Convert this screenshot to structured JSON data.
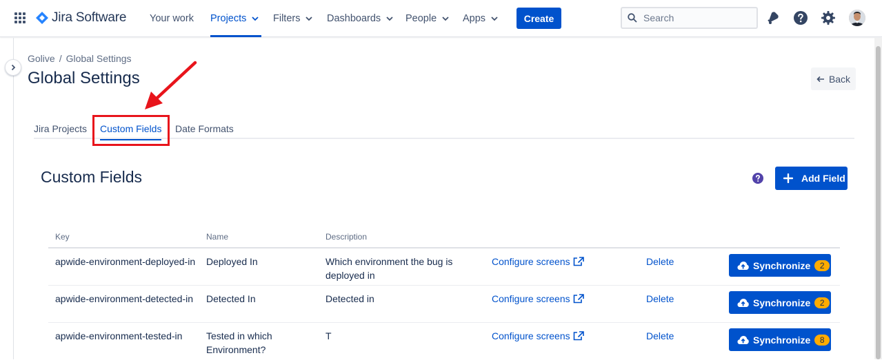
{
  "topnav": {
    "product_name": "Jira Software",
    "items": [
      {
        "label": "Your work",
        "has_menu": false
      },
      {
        "label": "Projects",
        "has_menu": true,
        "active": true
      },
      {
        "label": "Filters",
        "has_menu": true
      },
      {
        "label": "Dashboards",
        "has_menu": true
      },
      {
        "label": "People",
        "has_menu": true
      },
      {
        "label": "Apps",
        "has_menu": true
      }
    ],
    "create_label": "Create",
    "search_placeholder": "Search",
    "icons": [
      "app-switcher-icon",
      "notifications-icon",
      "help-icon",
      "settings-icon",
      "avatar"
    ]
  },
  "breadcrumb": {
    "root": "Golive",
    "separator": "/",
    "current": "Global Settings"
  },
  "page_title": "Global Settings",
  "back_label": "Back",
  "tabs": [
    {
      "label": "Jira Projects"
    },
    {
      "label": "Custom Fields",
      "active": true
    },
    {
      "label": "Date Formats"
    }
  ],
  "section": {
    "title": "Custom Fields",
    "add_label": "Add Field"
  },
  "table": {
    "headers": {
      "key": "Key",
      "name": "Name",
      "description": "Description"
    },
    "rows": [
      {
        "key": "apwide-environment-deployed-in",
        "name": "Deployed In",
        "description": "Which environment the bug is deployed in",
        "configure": "Configure screens",
        "delete": "Delete",
        "sync": "Synchronize",
        "count": "2"
      },
      {
        "key": "apwide-environment-detected-in",
        "name": "Detected In",
        "description": "Detected in",
        "configure": "Configure screens",
        "delete": "Delete",
        "sync": "Synchronize",
        "count": "2"
      },
      {
        "key": "apwide-environment-tested-in",
        "name": "Tested in which Environment?",
        "description": "T",
        "configure": "Configure screens",
        "delete": "Delete",
        "sync": "Synchronize",
        "count": "8"
      }
    ]
  },
  "colors": {
    "primary": "#0052cc",
    "annotation": "#e8141b",
    "badge": "#ffab00"
  }
}
